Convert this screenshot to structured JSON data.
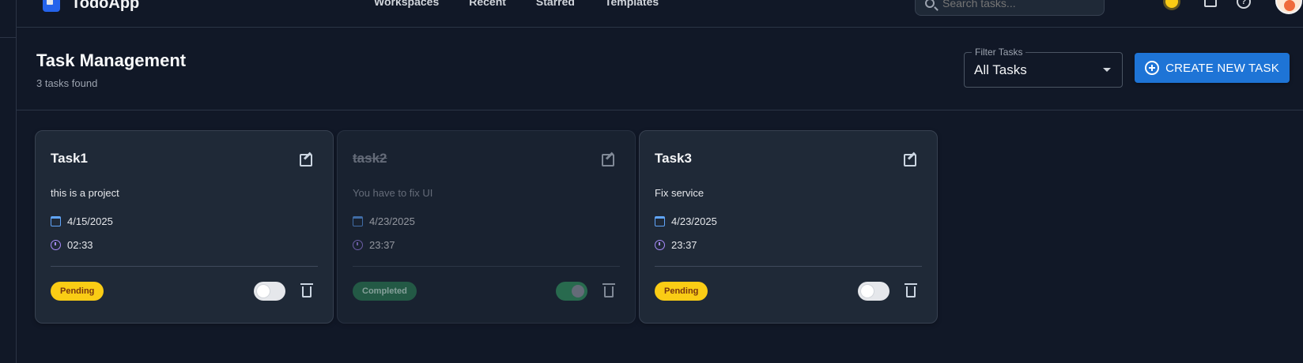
{
  "app": {
    "name": "TodoApp"
  },
  "nav": {
    "items": [
      "Workspaces",
      "Recent",
      "Starred",
      "Templates"
    ]
  },
  "search": {
    "placeholder": "Search tasks..."
  },
  "header": {
    "title": "Task Management",
    "count": "3 tasks found"
  },
  "filter": {
    "label": "Filter Tasks",
    "value": "All Tasks"
  },
  "create_button": {
    "label": "CREATE NEW TASK"
  },
  "colors": {
    "background": "#111827",
    "card": "#1f2937",
    "accent": "#1e74d6",
    "pending": "#facc15",
    "completed": "#2f855a"
  },
  "icons": {
    "logo": "app-logo",
    "search": "search-icon",
    "theme": "sun-icon",
    "notifications": "bell-icon",
    "help": "help-icon",
    "create": "plus-circle-icon",
    "edit": "edit-icon",
    "date": "calendar-icon",
    "time": "clock-icon",
    "delete": "trash-icon"
  },
  "tasks": [
    {
      "title": "Task1",
      "description": "this is a project",
      "date": "4/15/2025",
      "time": "02:33",
      "status": "Pending",
      "completed": false
    },
    {
      "title": "task2",
      "description": "You have to fix UI",
      "date": "4/23/2025",
      "time": "23:37",
      "status": "Completed",
      "completed": true
    },
    {
      "title": "Task3",
      "description": "Fix service",
      "date": "4/23/2025",
      "time": "23:37",
      "status": "Pending",
      "completed": false
    }
  ]
}
